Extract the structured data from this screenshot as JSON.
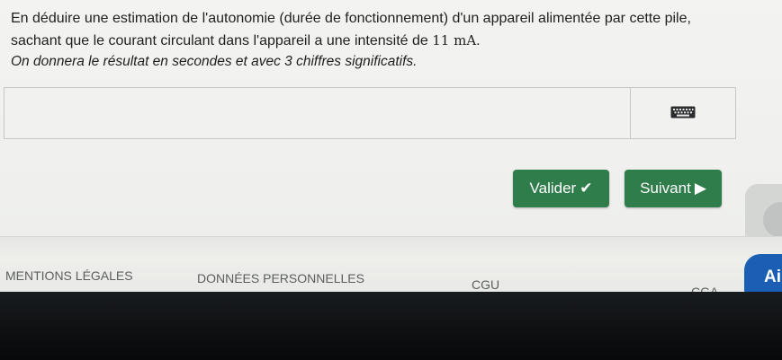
{
  "question": {
    "line1": "En déduire une estimation de l'autonomie (durée de fonctionnement) d'un appareil alimentée par cette pile,",
    "line2_a": "sachant que le courant circulant dans l'appareil a une intensité de ",
    "line2_value": "11 mA",
    "line2_b": ".",
    "line3": "On donnera le résultat en secondes et avec 3 chiffres significatifs."
  },
  "answer": {
    "value": "",
    "placeholder": ""
  },
  "buttons": {
    "valider": "Valider",
    "valider_icon": "✔",
    "suivant": "Suivant",
    "suivant_icon": "▶"
  },
  "footer": {
    "mentions": "MENTIONS LÉGALES",
    "donnees": "DONNÉES PERSONNELLES",
    "cgu": "CGU",
    "cga": "CGA"
  },
  "chat": {
    "label": "Ai"
  },
  "icons": {
    "keyboard": "keyboard-icon",
    "check": "check-icon",
    "arrow": "play-arrow-icon"
  },
  "colors": {
    "button_green": "#2f7d4a",
    "chat_blue": "#1b5fb4"
  }
}
